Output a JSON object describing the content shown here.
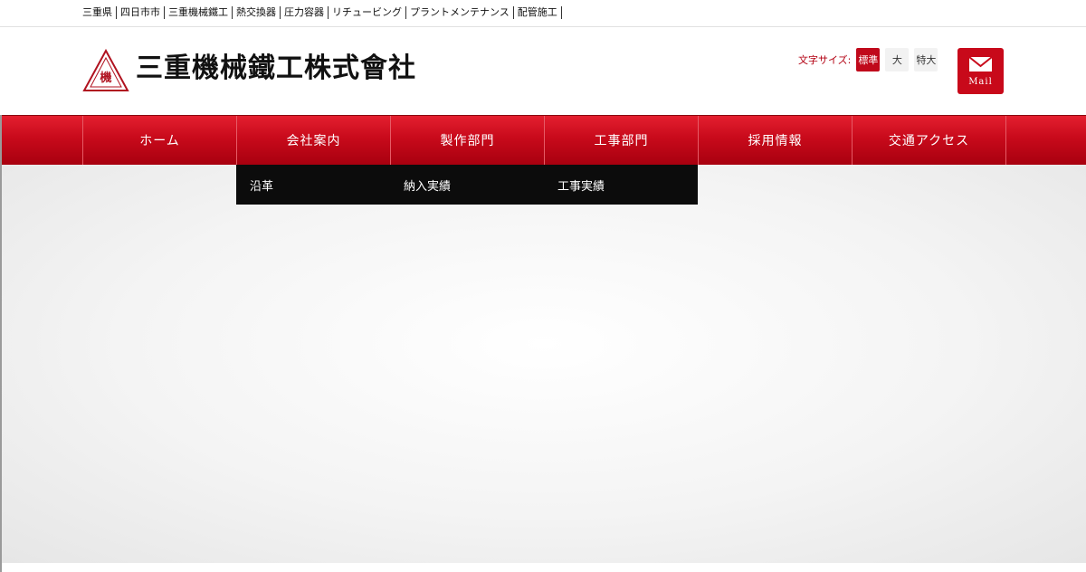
{
  "topbar": {
    "keywords": [
      "三重県",
      "四日市市",
      "三重機械鐵工",
      "熱交換器",
      "圧力容器",
      "リチュービング",
      "プラントメンテナンス",
      "配管施工"
    ]
  },
  "header": {
    "logo_mark_text": "機",
    "logo_text": "三重機械鐵工株式會社",
    "fontsize": {
      "label": "文字サイズ:",
      "options": [
        "標準",
        "大",
        "特大"
      ],
      "selected": "標準"
    },
    "mail_label": "Mail",
    "brand_color": "#c8091a"
  },
  "gnav": {
    "items": [
      "ホーム",
      "会社案内",
      "製作部門",
      "工事部門",
      "採用情報",
      "交通アクセス"
    ]
  },
  "subnav": {
    "items": [
      "沿革",
      "納入実績",
      "工事実績"
    ]
  }
}
